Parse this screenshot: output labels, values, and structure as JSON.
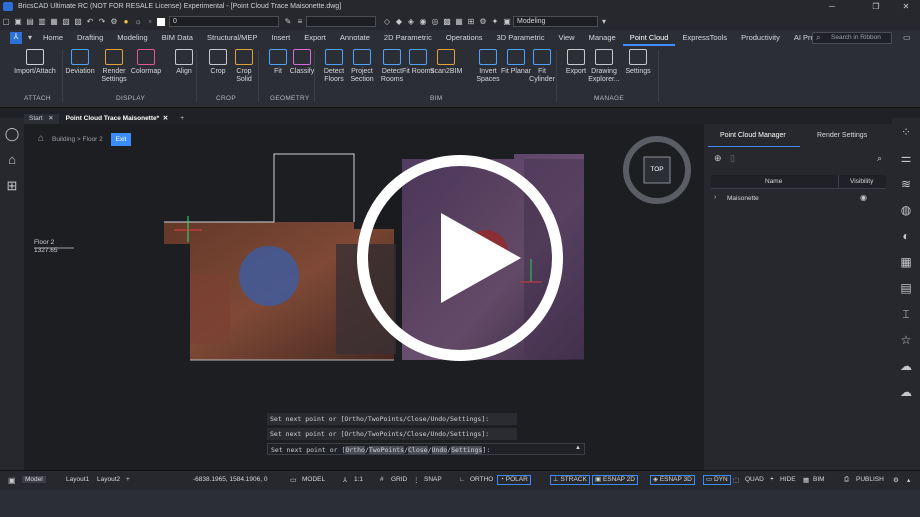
{
  "titlebar": {
    "title": "BricsCAD Ultimate RC (NOT FOR RESALE License) Experimental - [Point Cloud Trace Maisonette.dwg]",
    "minimize": "─",
    "maximize": "❐",
    "close": "✕"
  },
  "qat": {
    "layer_value": "0",
    "workspace_value": "Modeling"
  },
  "ribbon_tabs": [
    "Home",
    "Drafting",
    "Modeling",
    "BIM Data",
    "Structural/MEP",
    "Insert",
    "Export",
    "Annotate",
    "2D Parametric",
    "Operations",
    "3D Parametric",
    "View",
    "Manage",
    "Point Cloud",
    "ExpressTools",
    "Productivity",
    "AI Predict"
  ],
  "active_tab": "Point Cloud",
  "search_placeholder": "Search in Ribbon",
  "ribbon": {
    "buttons": [
      {
        "label": "Import/Attach",
        "group": "ATTACH"
      },
      {
        "label": "Deviation",
        "group": "DISPLAY"
      },
      {
        "label": "Render Settings",
        "group": "DISPLAY"
      },
      {
        "label": "Colormap",
        "group": "DISPLAY"
      },
      {
        "label": "Align",
        "group": "DISPLAY"
      },
      {
        "label": "Crop",
        "group": "CROP"
      },
      {
        "label": "Crop Solid",
        "group": "CROP"
      },
      {
        "label": "Fit",
        "group": "GEOMETRY"
      },
      {
        "label": "Classify",
        "group": "GEOMETRY"
      },
      {
        "label": "Detect Floors",
        "group": "BIM"
      },
      {
        "label": "Project Section",
        "group": "BIM"
      },
      {
        "label": "Detect Rooms",
        "group": "BIM"
      },
      {
        "label": "Fit Rooms",
        "group": "BIM"
      },
      {
        "label": "Scan2BIM",
        "group": "BIM"
      },
      {
        "label": "Invert Spaces",
        "group": "BIM"
      },
      {
        "label": "Fit Planar",
        "group": "BIM"
      },
      {
        "label": "Fit Cylinder",
        "group": "BIM"
      },
      {
        "label": "Export",
        "group": "MANAGE"
      },
      {
        "label": "Drawing Explorer...",
        "group": "MANAGE"
      },
      {
        "label": "Settings",
        "group": "MANAGE"
      }
    ],
    "groups": [
      "ATTACH",
      "DISPLAY",
      "CROP",
      "GEOMETRY",
      "BIM",
      "MANAGE"
    ]
  },
  "doc_tabs": [
    {
      "label": "Start",
      "close": "✕"
    },
    {
      "label": "Point Cloud Trace Maisonette*",
      "close": "✕"
    },
    {
      "label": "+"
    }
  ],
  "viewport": {
    "breadcrumb": "Building > Floor 2",
    "exit_label": "Exit",
    "floor_label": "Floor 2",
    "floor_elevation": "1327.65",
    "viewcube_label": "TOP"
  },
  "command_lines": [
    "Set next point or [Ortho/TwoPoints/Close/Undo/Settings]:",
    "Set next point or [Ortho/TwoPoints/Close/Undo/Settings]:"
  ],
  "command_prompt": {
    "prefix": "Set next point or [",
    "options": [
      "Ortho",
      "TwoPoints",
      "Close",
      "Undo",
      "Settings"
    ],
    "suffix": "]:"
  },
  "right_panel": {
    "tabs": [
      "Point Cloud Manager",
      "Render Settings"
    ],
    "col_name": "Name",
    "col_visibility": "Visibility",
    "rows": [
      {
        "name": "Maisonette"
      }
    ]
  },
  "statusbar": {
    "layouts": [
      "Model",
      "Layout1",
      "Layout2"
    ],
    "coords": "-6838.1965, 1584.1906, 0",
    "model": "MODEL",
    "scale": "1:1",
    "grid": "GRID",
    "snap": "SNAP",
    "ortho": "ORTHO",
    "polar": "POLAR",
    "strack": "STRACK",
    "esnap2d": "ESNAP 2D",
    "esnap3d": "ESNAP 3D",
    "dyn": "DYN",
    "quad": "QUAD",
    "hide": "HIDE",
    "bim": "BIM",
    "publish": "PUBLISH"
  },
  "colors": {
    "accent": "#3b8cff",
    "background": "#1c1e22",
    "panel": "#2b2e34"
  }
}
